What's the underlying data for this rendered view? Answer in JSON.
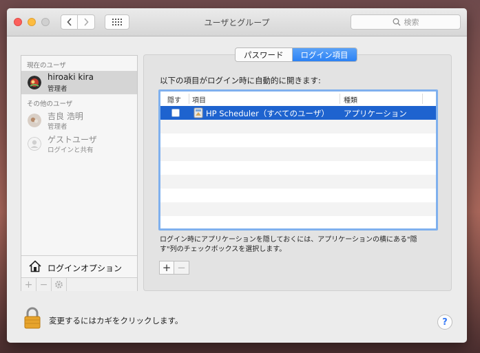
{
  "window": {
    "title": "ユーザとグループ"
  },
  "search": {
    "placeholder": "検索"
  },
  "sidebar": {
    "current_section": "現在のユーザ",
    "other_section": "その他のユーザ",
    "users": [
      {
        "name": "hiroaki kira",
        "role": "管理者",
        "selected": true
      },
      {
        "name": "吉良 浩明",
        "role": "管理者",
        "selected": false
      },
      {
        "name": "ゲストユーザ",
        "role": "ログインと共有",
        "selected": false
      }
    ],
    "login_options": "ログインオプション",
    "tools": {
      "add": "+",
      "remove": "−"
    }
  },
  "tabs": [
    {
      "label": "パスワード",
      "active": false
    },
    {
      "label": "ログイン項目",
      "active": true
    }
  ],
  "login_items": {
    "caption": "以下の項目がログイン時に自動的に開きます:",
    "columns": {
      "hide": "隠す",
      "item": "項目",
      "kind": "種類"
    },
    "rows": [
      {
        "hidden": false,
        "item": "HP Scheduler（すべてのユーザ）",
        "kind": "アプリケーション",
        "selected": true
      }
    ],
    "note": "ログイン時にアプリケーションを隠しておくには、アプリケーションの横にある\"隠す\"列のチェックボックスを選択します。",
    "add_label": "+",
    "remove_label": "−"
  },
  "footer": {
    "lock_text": "変更するにはカギをクリックします。",
    "help_label": "?"
  },
  "colors": {
    "accent": "#2c82f4",
    "selection": "#1e63cf",
    "close": "#fc605c",
    "minimize": "#fdbc40"
  }
}
